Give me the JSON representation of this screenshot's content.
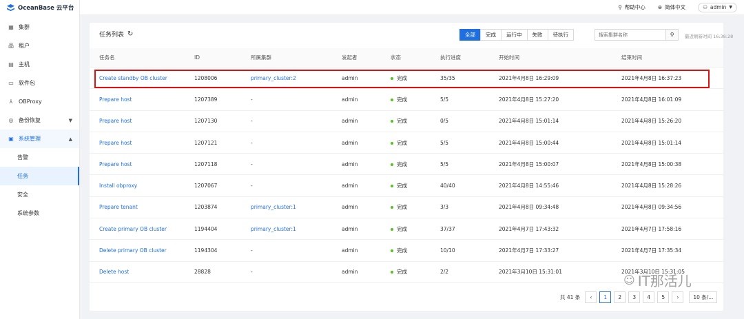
{
  "app": {
    "logo_text": "OceanBase 云平台"
  },
  "topbar": {
    "help": "帮助中心",
    "language": "简体中文",
    "user": "admin"
  },
  "sidebar": {
    "items": [
      {
        "label": "集群",
        "icon": "cluster-icon"
      },
      {
        "label": "租户",
        "icon": "tenant-icon"
      },
      {
        "label": "主机",
        "icon": "host-icon"
      },
      {
        "label": "软件包",
        "icon": "folder-icon"
      },
      {
        "label": "OBProxy",
        "icon": "proxy-icon"
      },
      {
        "label": "备份恢复",
        "icon": "backup-icon"
      },
      {
        "label": "系统管理",
        "icon": "system-icon"
      }
    ],
    "sub_items": [
      {
        "label": "告警"
      },
      {
        "label": "任务"
      },
      {
        "label": "安全"
      },
      {
        "label": "系统参数"
      }
    ]
  },
  "main": {
    "title": "任务列表",
    "filters": [
      "全部",
      "完成",
      "运行中",
      "失败",
      "待执行"
    ],
    "active_filter": "全部",
    "search_placeholder": "搜索集群名称",
    "refresh_time": "最近刷新时间 16:38:28",
    "columns": [
      "任务名",
      "ID",
      "所属集群",
      "发起者",
      "状态",
      "执行进度",
      "开始时间",
      "结束时间"
    ],
    "rows": [
      {
        "name": "Create standby OB cluster",
        "id": "1208006",
        "cluster": "primary_cluster:2",
        "owner": "admin",
        "status": "完成",
        "progress": "35/35",
        "start": "2021年4月8日 16:29:09",
        "end": "2021年4月8日 16:37:23"
      },
      {
        "name": "Prepare host",
        "id": "1207389",
        "cluster": "-",
        "owner": "admin",
        "status": "完成",
        "progress": "5/5",
        "start": "2021年4月8日 15:27:20",
        "end": "2021年4月8日 16:01:09"
      },
      {
        "name": "Prepare host",
        "id": "1207130",
        "cluster": "-",
        "owner": "admin",
        "status": "完成",
        "progress": "0/5",
        "start": "2021年4月8日 15:01:14",
        "end": "2021年4月8日 15:26:20"
      },
      {
        "name": "Prepare host",
        "id": "1207121",
        "cluster": "-",
        "owner": "admin",
        "status": "完成",
        "progress": "5/5",
        "start": "2021年4月8日 15:00:44",
        "end": "2021年4月8日 15:01:14"
      },
      {
        "name": "Prepare host",
        "id": "1207118",
        "cluster": "-",
        "owner": "admin",
        "status": "完成",
        "progress": "5/5",
        "start": "2021年4月8日 15:00:07",
        "end": "2021年4月8日 15:00:38"
      },
      {
        "name": "Install obproxy",
        "id": "1207067",
        "cluster": "-",
        "owner": "admin",
        "status": "完成",
        "progress": "40/40",
        "start": "2021年4月8日 14:55:46",
        "end": "2021年4月8日 15:28:26"
      },
      {
        "name": "Prepare tenant",
        "id": "1203874",
        "cluster": "primary_cluster:1",
        "owner": "admin",
        "status": "完成",
        "progress": "3/3",
        "start": "2021年4月8日 09:34:48",
        "end": "2021年4月8日 09:34:56"
      },
      {
        "name": "Create primary OB cluster",
        "id": "1194404",
        "cluster": "primary_cluster:1",
        "owner": "admin",
        "status": "完成",
        "progress": "37/37",
        "start": "2021年4月7日 17:43:32",
        "end": "2021年4月7日 17:58:16"
      },
      {
        "name": "Delete primary OB cluster",
        "id": "1194304",
        "cluster": "-",
        "owner": "admin",
        "status": "完成",
        "progress": "10/10",
        "start": "2021年4月7日 17:33:27",
        "end": "2021年4月7日 17:35:34"
      },
      {
        "name": "Delete host",
        "id": "28828",
        "cluster": "-",
        "owner": "admin",
        "status": "完成",
        "progress": "2/2",
        "start": "2021年3月10日 15:31:01",
        "end": "2021年3月10日 15:31:05"
      }
    ]
  },
  "pagination": {
    "total": "共 41 条",
    "pages": [
      "1",
      "2",
      "3",
      "4",
      "5"
    ],
    "current": "1",
    "page_size": "10 条/..."
  },
  "watermark": "IT那活儿",
  "colors": {
    "accent": "#1f6fe0",
    "success": "#52c41a",
    "highlight": "#e01010"
  }
}
